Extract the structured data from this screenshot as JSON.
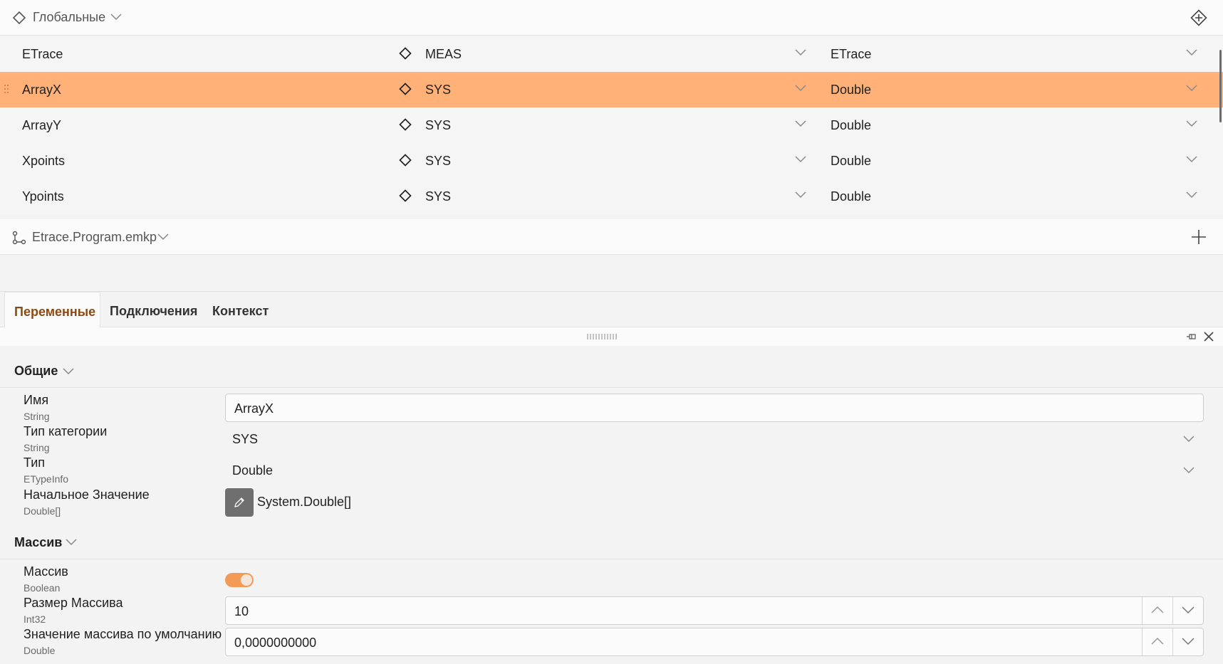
{
  "globals": {
    "title": "Глобальные",
    "rows": [
      {
        "name": "ETrace",
        "category": "MEAS",
        "type": "ETrace",
        "selected": false
      },
      {
        "name": "ArrayX",
        "category": "SYS",
        "type": "Double",
        "selected": true
      },
      {
        "name": "ArrayY",
        "category": "SYS",
        "type": "Double",
        "selected": false
      },
      {
        "name": "Xpoints",
        "category": "SYS",
        "type": "Double",
        "selected": false
      },
      {
        "name": "Ypoints",
        "category": "SYS",
        "type": "Double",
        "selected": false
      }
    ]
  },
  "program": {
    "title": "Etrace.Program.emkp"
  },
  "tabs": [
    {
      "label": "Переменные",
      "active": true
    },
    {
      "label": "Подключения",
      "active": false
    },
    {
      "label": "Контекст",
      "active": false
    }
  ],
  "sections": {
    "general": {
      "title": "Общие",
      "props": {
        "name": {
          "label": "Имя",
          "type": "String",
          "value": "ArrayX"
        },
        "category": {
          "label": "Тип категории",
          "type": "String",
          "value": "SYS"
        },
        "type": {
          "label": "Тип",
          "type": "ETypeInfo",
          "value": "Double"
        },
        "initial": {
          "label": "Начальное Значение",
          "type": "Double[]",
          "value": "System.Double[]"
        }
      }
    },
    "array": {
      "title": "Массив",
      "props": {
        "is_array": {
          "label": "Массив",
          "type": "Boolean",
          "value": true
        },
        "size": {
          "label": "Размер Массива",
          "type": "Int32",
          "value": "10"
        },
        "default": {
          "label": "Значение массива по умолчанию",
          "type": "Double",
          "value": "0,0000000000"
        }
      }
    }
  },
  "colors": {
    "selected_row": "#ffb177",
    "accent": "#f39a57",
    "active_tab_text": "#8a4a14"
  }
}
